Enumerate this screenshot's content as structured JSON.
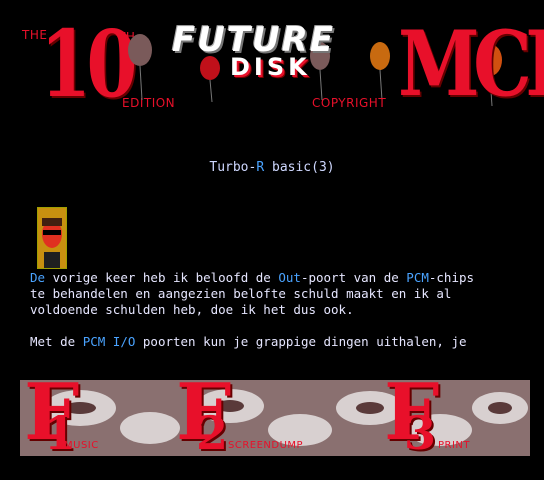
{
  "header": {
    "the": "THE",
    "number": "10",
    "th": "TH",
    "edition": "EDITION",
    "future": "FUTURE",
    "disk": "DISK",
    "copyright": "COPYRIGHT",
    "brand": "MCL"
  },
  "article": {
    "title_prefix": "Turbo-",
    "title_accent": "R",
    "title_suffix": " basic(3)",
    "lines": [
      [
        "De",
        " vorige keer heb ik beloofd de ",
        "Out",
        "-poort van de ",
        "PCM",
        "-chips"
      ],
      [
        "",
        "te behandelen en aangezien belofte schuld maakt en ik al"
      ],
      [
        "",
        "voldoende schulden heb, doe ik het dus ook."
      ],
      [
        "",
        "Met de ",
        "PCM I/O",
        " poorten kun je grappige dingen uithalen, je"
      ]
    ]
  },
  "footer": {
    "keys": [
      {
        "key": "F",
        "num": "1",
        "label": "MUSIC"
      },
      {
        "key": "F",
        "num": "2",
        "label": "SCREENDUMP"
      },
      {
        "key": "F",
        "num": "3",
        "label": "PRINT"
      }
    ]
  },
  "colors": {
    "background": "#000000",
    "logo_red": "#e8102a",
    "text": "#e6e6ff",
    "highlight_blue": "#4aa3ff"
  }
}
